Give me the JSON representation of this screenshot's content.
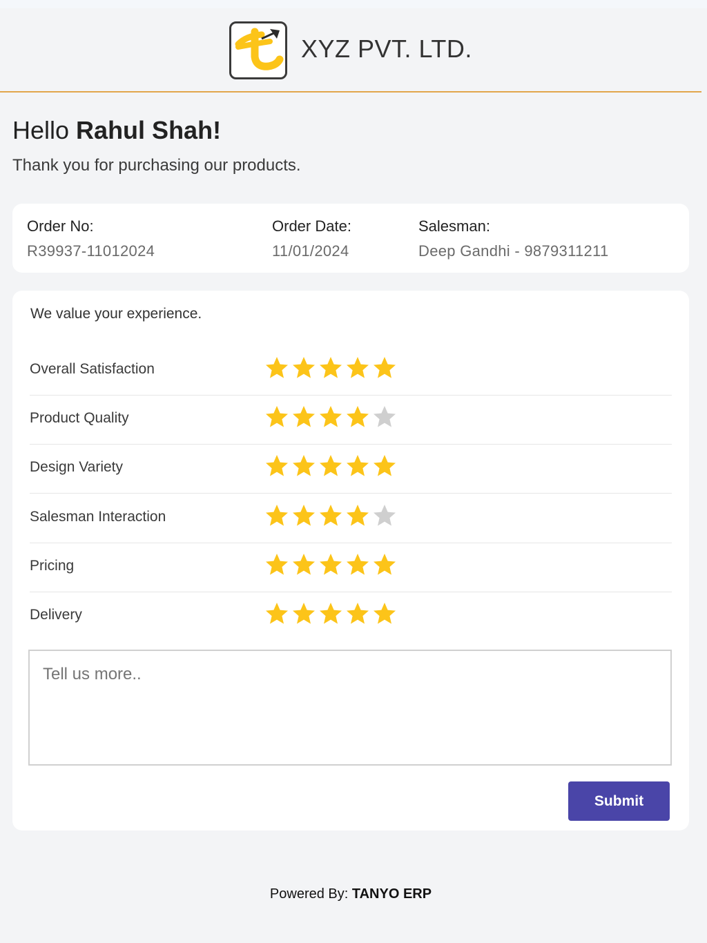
{
  "header": {
    "company_name": "XYZ PVT. LTD.",
    "logo_icon": "company-logo-icon",
    "divider_color": "#e2a64b"
  },
  "greeting": {
    "hello": "Hello ",
    "customer_name": "Rahul Shah!",
    "thanks": "Thank you for purchasing our products."
  },
  "order": {
    "order_no_label": "Order No:",
    "order_no": "R39937-11012024",
    "order_date_label": "Order Date:",
    "order_date": "11/01/2024",
    "salesman_label": "Salesman:",
    "salesman": "Deep Gandhi - 9879311211"
  },
  "feedback": {
    "intro": "We value your experience.",
    "star_colors": {
      "filled": "#fcc419",
      "empty": "#cfcfcf"
    },
    "max_stars": 5,
    "ratings": [
      {
        "label": "Overall Satisfaction",
        "value": 5
      },
      {
        "label": "Product Quality",
        "value": 4
      },
      {
        "label": "Design Variety",
        "value": 5
      },
      {
        "label": "Salesman Interaction",
        "value": 4
      },
      {
        "label": "Pricing",
        "value": 5
      },
      {
        "label": "Delivery",
        "value": 5
      }
    ],
    "comment_placeholder": "Tell us more..",
    "comment_value": "",
    "submit_label": "Submit",
    "submit_color": "#4a45a8"
  },
  "footer": {
    "powered_by": "Powered By: ",
    "brand": "TANYO ERP"
  }
}
